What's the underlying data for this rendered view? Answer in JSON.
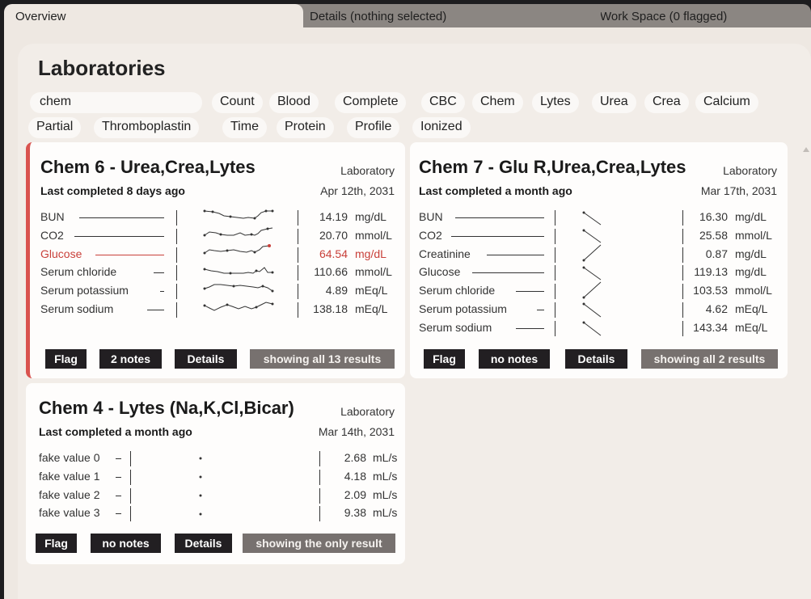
{
  "tabs": {
    "overview": "Overview",
    "details": "Details (nothing selected)",
    "workspace": "Work Space (0 flagged)"
  },
  "page": {
    "title": "Laboratories",
    "search_value": "chem",
    "filters": [
      "Count",
      "Blood",
      "Complete",
      "CBC",
      "Chem",
      "Lytes",
      "Urea",
      "Crea",
      "Calcium",
      "Partial",
      "Thromboplastin",
      "Time",
      "Protein",
      "Profile",
      "Ionized"
    ]
  },
  "colors": {
    "flag_accent": "#d9534f",
    "abnormal": "#c9403a",
    "button_dark": "#221f22",
    "button_grey": "#77716f"
  },
  "cards": [
    {
      "title": "Chem 6 - Urea,Crea,Lytes",
      "type": "Laboratory",
      "last_completed": "Last completed 8 days ago",
      "date": "Apr 12th, 2031",
      "flagged": true,
      "rows": [
        {
          "name": "BUN",
          "value": "14.19",
          "unit": "mg/dL",
          "abnormal": false
        },
        {
          "name": "CO2",
          "value": "20.70",
          "unit": "mmol/L",
          "abnormal": false
        },
        {
          "name": "Glucose",
          "value": "64.54",
          "unit": "mg/dL",
          "abnormal": true
        },
        {
          "name": "Serum chloride",
          "value": "110.66",
          "unit": "mmol/L",
          "abnormal": false
        },
        {
          "name": "Serum potassium",
          "value": "4.89",
          "unit": "mEq/L",
          "abnormal": false
        },
        {
          "name": "Serum sodium",
          "value": "138.18",
          "unit": "mEq/L",
          "abnormal": false
        }
      ],
      "buttons": {
        "flag": "Flag",
        "notes": "2 notes",
        "details": "Details",
        "results": "showing all 13 results"
      }
    },
    {
      "title": "Chem 7 - Glu R,Urea,Crea,Lytes",
      "type": "Laboratory",
      "last_completed": "Last completed a month ago",
      "date": "Mar 17th, 2031",
      "flagged": false,
      "rows": [
        {
          "name": "BUN",
          "value": "16.30",
          "unit": "mg/dL",
          "abnormal": false
        },
        {
          "name": "CO2",
          "value": "25.58",
          "unit": "mmol/L",
          "abnormal": false
        },
        {
          "name": "Creatinine",
          "value": "0.87",
          "unit": "mg/dL",
          "abnormal": false
        },
        {
          "name": "Glucose",
          "value": "119.13",
          "unit": "mg/dL",
          "abnormal": false
        },
        {
          "name": "Serum chloride",
          "value": "103.53",
          "unit": "mmol/L",
          "abnormal": false
        },
        {
          "name": "Serum potassium",
          "value": "4.62",
          "unit": "mEq/L",
          "abnormal": false
        },
        {
          "name": "Serum sodium",
          "value": "143.34",
          "unit": "mEq/L",
          "abnormal": false
        }
      ],
      "buttons": {
        "flag": "Flag",
        "notes": "no notes",
        "details": "Details",
        "results": "showing all 2 results"
      }
    },
    {
      "title": "Chem 4 - Lytes (Na,K,Cl,Bicar)",
      "type": "Laboratory",
      "last_completed": "Last completed a month ago",
      "date": "Mar 14th, 2031",
      "flagged": false,
      "rows": [
        {
          "name": "fake value 0",
          "value": "2.68",
          "unit": "mL/s",
          "abnormal": false
        },
        {
          "name": "fake value 1",
          "value": "4.18",
          "unit": "mL/s",
          "abnormal": false
        },
        {
          "name": "fake value 2",
          "value": "2.09",
          "unit": "mL/s",
          "abnormal": false
        },
        {
          "name": "fake value 3",
          "value": "9.38",
          "unit": "mL/s",
          "abnormal": false
        }
      ],
      "buttons": {
        "flag": "Flag",
        "notes": "no notes",
        "details": "Details",
        "results": "showing the only result"
      }
    }
  ]
}
